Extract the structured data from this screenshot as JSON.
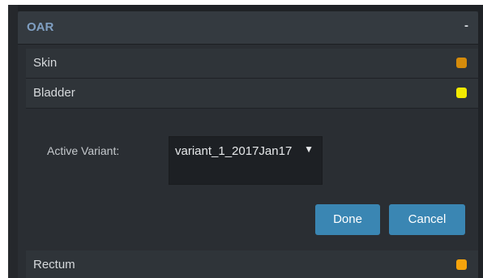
{
  "panel": {
    "title": "OAR",
    "collapse_symbol": "-"
  },
  "structures": [
    {
      "label": "Skin",
      "color": "#d58b0b"
    },
    {
      "label": "Bladder",
      "color": "#f2ea00"
    },
    {
      "label": "Rectum",
      "color": "#f5a30c"
    }
  ],
  "editor": {
    "active_variant_label": "Active Variant:",
    "active_variant_value": "variant_1_2017Jan17",
    "dropdown_arrow": "▼",
    "done_label": "Done",
    "cancel_label": "Cancel"
  },
  "colors": {
    "accent_button": "#3a86b3",
    "header_text": "#7f9fc2"
  },
  "icons": {
    "dropdown": "chevron-down-icon"
  }
}
